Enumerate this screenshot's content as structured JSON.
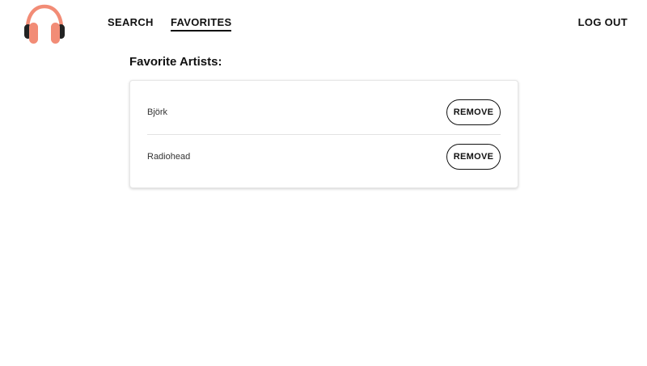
{
  "nav": {
    "search_label": "SEARCH",
    "favorites_label": "FAVORITES",
    "logout_label": "LOG OUT",
    "active": "FAVORITES"
  },
  "logo": {
    "icon": "headphones-icon",
    "band_color": "#f28c76",
    "cup_color": "#f28c76",
    "ear_color": "#222222"
  },
  "main": {
    "title": "Favorite Artists:",
    "artists": [
      {
        "name": "Björk",
        "action_label": "REMOVE"
      },
      {
        "name": "Radiohead",
        "action_label": "REMOVE"
      }
    ]
  }
}
